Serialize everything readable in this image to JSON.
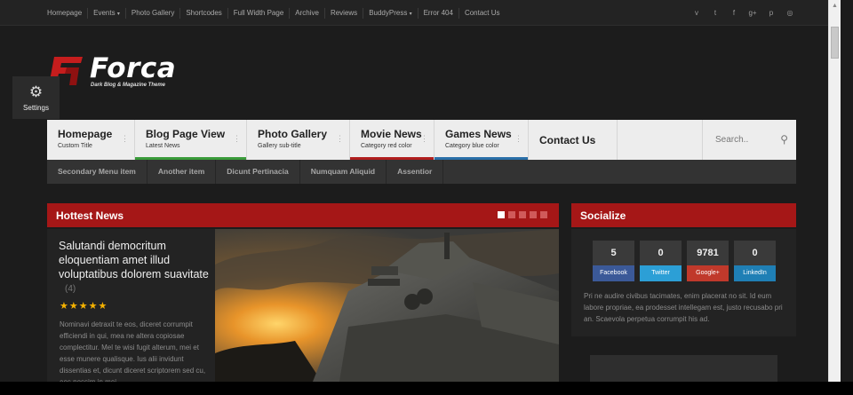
{
  "topnav": {
    "items": [
      "Homepage",
      "Events",
      "Photo Gallery",
      "Shortcodes",
      "Full Width Page",
      "Archive",
      "Reviews",
      "BuddyPress",
      "Error 404",
      "Contact Us"
    ],
    "dropdown_marker": "▾"
  },
  "social_icons": [
    {
      "name": "vimeo-icon",
      "glyph": "v"
    },
    {
      "name": "twitter-icon",
      "glyph": "t"
    },
    {
      "name": "facebook-icon",
      "glyph": "f"
    },
    {
      "name": "google-plus-icon",
      "glyph": "g+"
    },
    {
      "name": "pinterest-icon",
      "glyph": "p"
    },
    {
      "name": "dribbble-icon",
      "glyph": "◎"
    }
  ],
  "logo": {
    "title": "Forca",
    "subtitle": "Dark Blog & Magazine Theme"
  },
  "settings": {
    "label": "Settings",
    "icon": "gear-icon"
  },
  "mainmenu": [
    {
      "title": "Homepage",
      "subtitle": "Custom Title",
      "color": ""
    },
    {
      "title": "Blog Page View",
      "subtitle": "Latest News",
      "color": "#3a9b3a"
    },
    {
      "title": "Photo Gallery",
      "subtitle": "Gallery sub-title",
      "color": ""
    },
    {
      "title": "Movie News",
      "subtitle": "Category red color",
      "color": "#b01e1e"
    },
    {
      "title": "Games News",
      "subtitle": "Category blue color",
      "color": "#2a6fa8"
    },
    {
      "title": "Contact Us",
      "subtitle": "",
      "color": ""
    }
  ],
  "search": {
    "placeholder": "Search.."
  },
  "submenu": [
    "Secondary Menu item",
    "Another item",
    "Dicunt Pertinacia",
    "Numquam Aliquid",
    "Assentior"
  ],
  "hottest": {
    "title": "Hottest News",
    "headline": "Salutandi democritum eloquentiam amet illud voluptatibus dolorem suavitate",
    "count": "(4)",
    "rating": "★★★★★",
    "rating_value": 5,
    "excerpt": "Nominavi detraxit te eos, diceret corrumpit efficiendi in qui, mea ne altera copiosae complectitur. Mel te wisi fugit alterum, mei et esse munere qualisque. Ius alii invidunt dissentias et, dicunt diceret scriptorem sed cu, eos possim in mei.",
    "slides": 5,
    "active_slide": 1
  },
  "socialize": {
    "title": "Socialize",
    "counters": [
      {
        "count": "5",
        "network": "Facebook",
        "color": "#3b5998"
      },
      {
        "count": "0",
        "network": "Twitter",
        "color": "#2c9fd6"
      },
      {
        "count": "9781",
        "network": "Google+",
        "color": "#c0392b"
      },
      {
        "count": "0",
        "network": "LinkedIn",
        "color": "#1f7fb5"
      }
    ],
    "text": "Pri ne audire civibus tacimates, enim placerat no sit. Id eum labore propriae, ea prodesset intellegam est, justo recusabo pri an. Scaevola perpetua corrumpit his ad."
  }
}
